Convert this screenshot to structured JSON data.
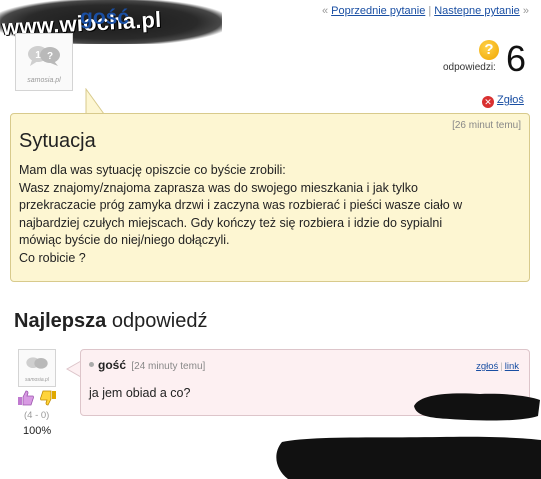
{
  "watermark": {
    "text": "www.wiocha.pl"
  },
  "nav": {
    "prev": "Poprzednie pytanie",
    "next": "Nastepne pytanie",
    "open": "«",
    "close": "»"
  },
  "question": {
    "author": "gość",
    "avatar_caption": "samosia.pl",
    "answers_label": "odpowiedzi:",
    "answers_count": "6",
    "report": "Zgłoś",
    "time": "[26 minut temu]",
    "title": "Sytuacja",
    "body_lines": [
      "Mam dla was sytuację opiszcie co byście zrobili:",
      "Wasz znajomy/znajoma zaprasza was do swojego mieszkania i jak tylko",
      "przekraczacie próg zamyka drzwi i zaczyna was rozbierać i pieści wasze ciało w",
      "najbardziej czułych miejscach. Gdy kończy też się rozbiera i idzie do sypialni",
      "mówiąc byście do niej/niego dołączyli.",
      "Co robicie ?"
    ]
  },
  "best_answer": {
    "heading_bold": "Najlepsza",
    "heading_rest": "odpowiedź",
    "avatar_caption": "samosia.pl",
    "author": "gość",
    "time": "[24 minuty temu]",
    "report": "zgłoś",
    "link": "link",
    "text": "ja jem obiad a co?",
    "votes": "(4 - 0)",
    "percent": "100%"
  },
  "colors": {
    "link": "#1a4fa3",
    "question_bg": "#fdf6d2",
    "answer_bg": "#fdf0f2"
  }
}
